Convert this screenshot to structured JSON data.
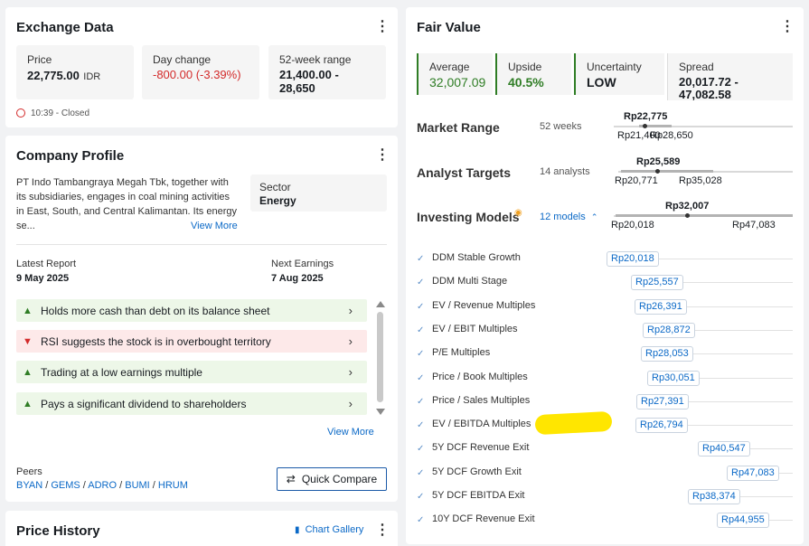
{
  "exchange": {
    "title": "Exchange Data",
    "price_label": "Price",
    "price_value": "22,775.00",
    "price_currency": "IDR",
    "day_change_label": "Day change",
    "day_change_value": "-800.00 (-3.39%)",
    "range_label": "52-week range",
    "range_value_1": "21,400.00 -",
    "range_value_2": "28,650",
    "time": "10:39 - Closed"
  },
  "profile": {
    "title": "Company Profile",
    "desc_1": "PT Indo Tambangraya Megah Tbk, together with",
    "desc_2": "its subsidiaries, engages in coal mining activities",
    "desc_3": "in East, South, and Central Kalimantan. Its energy",
    "desc_4": "se...",
    "view_more": "View More",
    "sector_label": "Sector",
    "sector_value": "Energy",
    "latest_report_label": "Latest Report",
    "latest_report_value": "9 May 2025",
    "next_earnings_label": "Next Earnings",
    "next_earnings_value": "7 Aug 2025",
    "insights": [
      {
        "text": "Holds more cash than debt on its balance sheet",
        "type": "positive"
      },
      {
        "text": "RSI suggests the stock is in overbought territory",
        "type": "negative"
      },
      {
        "text": "Trading at a low earnings multiple",
        "type": "positive"
      },
      {
        "text": "Pays a significant dividend to shareholders",
        "type": "positive"
      }
    ],
    "insights_view_more": "View More",
    "peers_label": "Peers",
    "peers": [
      "BYAN",
      "GEMS",
      "ADRO",
      "BUMI",
      "HRUM"
    ],
    "quick_compare": "Quick Compare"
  },
  "price_history": {
    "title": "Price History",
    "chart_gallery": "Chart Gallery"
  },
  "fair_value": {
    "title": "Fair Value",
    "average_label": "Average",
    "average_value": "32,007.09",
    "upside_label": "Upside",
    "upside_value": "40.5%",
    "uncertainty_label": "Uncertainty",
    "uncertainty_value": "LOW",
    "spread_label": "Spread",
    "spread_value_1": "20,017.72 -",
    "spread_value_2": "47,082.58",
    "market_range": {
      "title": "Market Range",
      "sub": "52 weeks",
      "current": "Rp22,775",
      "low": "Rp21,400",
      "high": "Rp28,650"
    },
    "analyst_targets": {
      "title": "Analyst Targets",
      "sub": "14 analysts",
      "current": "Rp25,589",
      "low": "Rp20,771",
      "high": "Rp35,028"
    },
    "investing_models": {
      "title": "Investing Models",
      "sub": "12 models",
      "current": "Rp32,007",
      "low": "Rp20,018",
      "high": "Rp47,083"
    },
    "models": [
      {
        "name": "DDM Stable Growth",
        "value": "Rp20,018"
      },
      {
        "name": "DDM Multi Stage",
        "value": "Rp25,557"
      },
      {
        "name": "EV / Revenue Multiples",
        "value": "Rp26,391"
      },
      {
        "name": "EV / EBIT Multiples",
        "value": "Rp28,872"
      },
      {
        "name": "P/E Multiples",
        "value": "Rp28,053"
      },
      {
        "name": "Price / Book Multiples",
        "value": "Rp30,051"
      },
      {
        "name": "Price / Sales Multiples",
        "value": "Rp27,391"
      },
      {
        "name": "EV / EBITDA Multiples",
        "value": "Rp26,794"
      },
      {
        "name": "5Y DCF Revenue Exit",
        "value": "Rp40,547"
      },
      {
        "name": "5Y DCF Growth Exit",
        "value": "Rp47,083"
      },
      {
        "name": "5Y DCF EBITDA Exit",
        "value": "Rp38,374"
      },
      {
        "name": "10Y DCF Revenue Exit",
        "value": "Rp44,955"
      }
    ]
  },
  "colors": {
    "negative": "#d32a2a",
    "positive": "#2f7d25",
    "link": "#0b69c7",
    "highlight": "#ffe600"
  }
}
